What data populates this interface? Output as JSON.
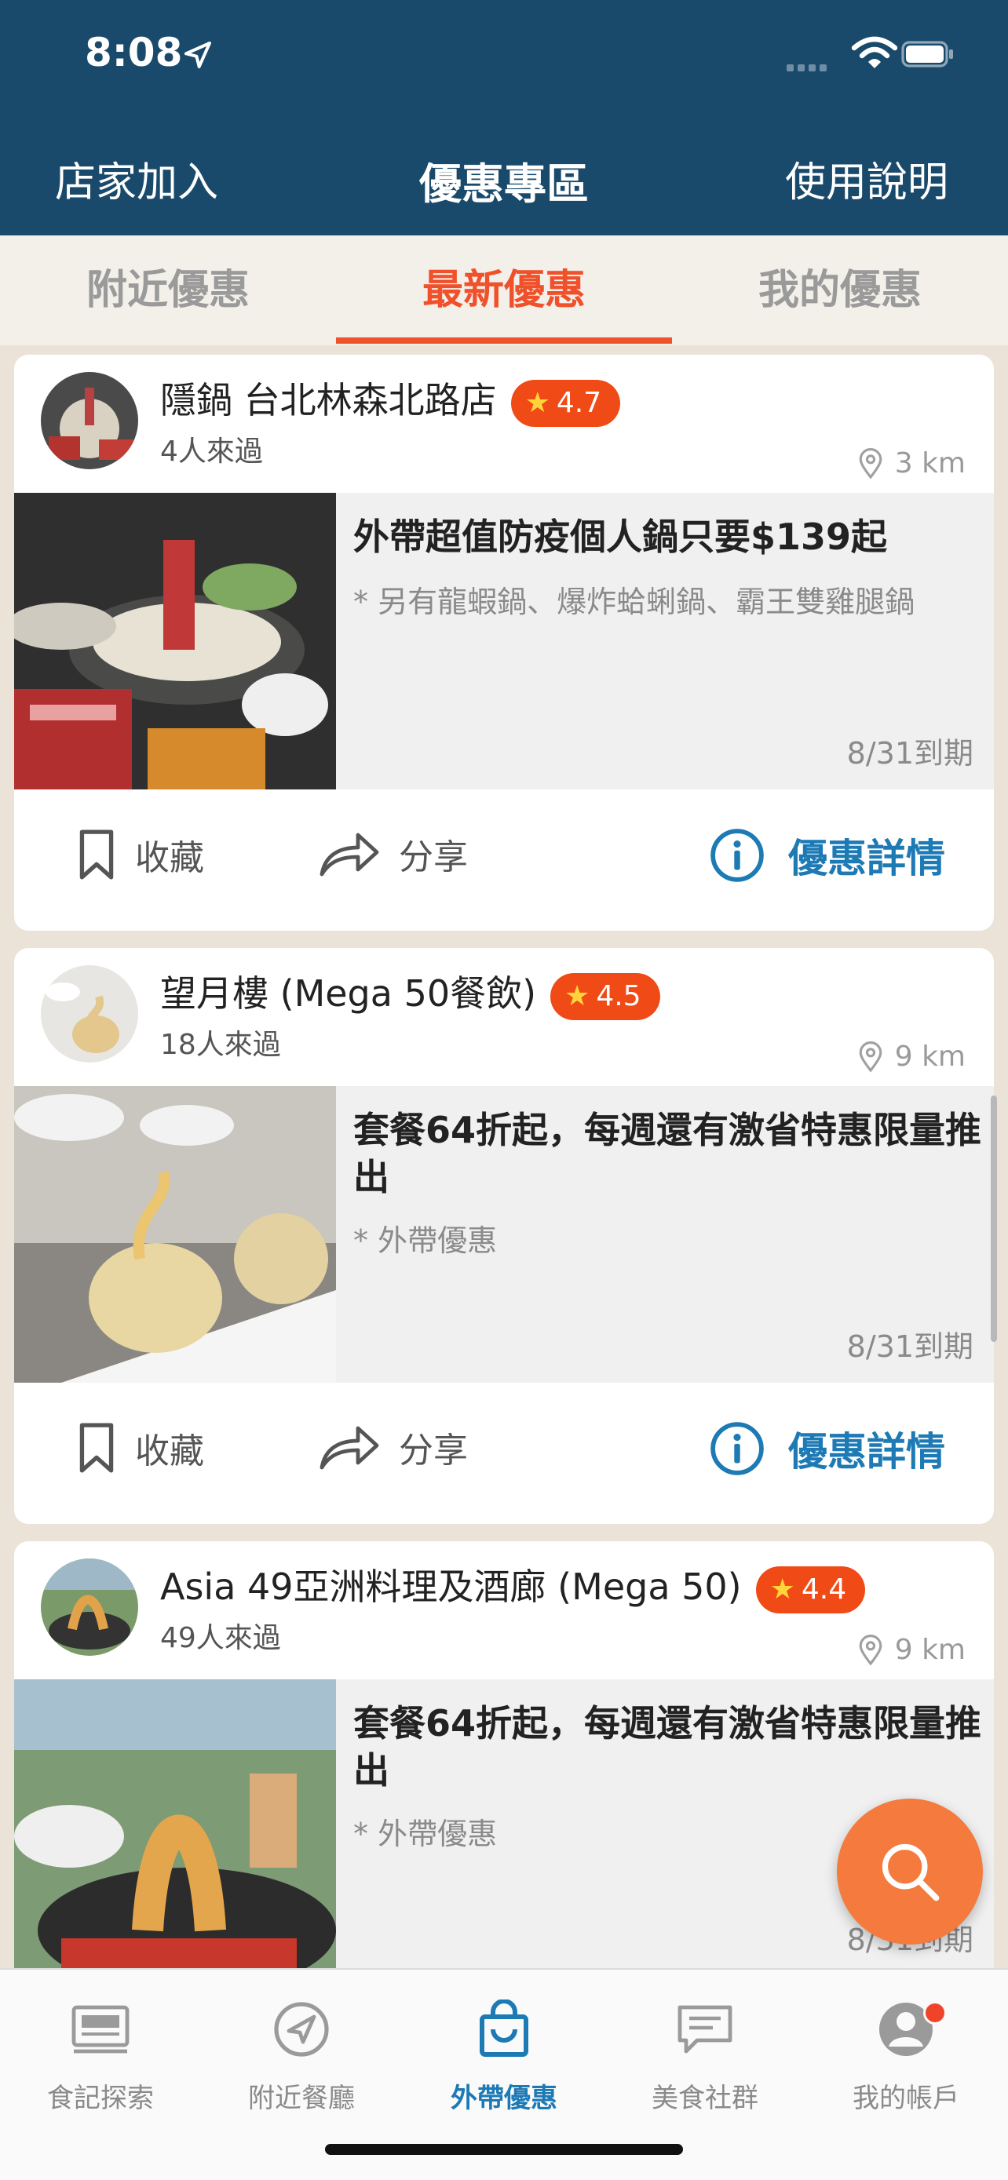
{
  "status_bar": {
    "time": "8:08"
  },
  "header": {
    "left": "店家加入",
    "title": "優惠專區",
    "right": "使用說明"
  },
  "tabs": [
    {
      "label": "附近優惠",
      "active": false
    },
    {
      "label": "最新優惠",
      "active": true
    },
    {
      "label": "我的優惠",
      "active": false
    }
  ],
  "cards": [
    {
      "store": "隱鍋 台北林森北路店",
      "rating": "4.7",
      "visits": "4人來過",
      "distance": "3 km",
      "deal_title": "外帶超值防疫個人鍋只要$139起",
      "deal_sub": "* 另有龍蝦鍋、爆炸蛤蜊鍋、霸王雙雞腿鍋",
      "expiry": "8/31到期",
      "save": "收藏",
      "share": "分享",
      "detail": "優惠詳情"
    },
    {
      "store": "望月樓 (Mega 50餐飲)",
      "rating": "4.5",
      "visits": "18人來過",
      "distance": "9 km",
      "deal_title": "套餐64折起，每週還有激省特惠限量推出",
      "deal_sub": "* 外帶優惠",
      "expiry": "8/31到期",
      "save": "收藏",
      "share": "分享",
      "detail": "優惠詳情"
    },
    {
      "store": "Asia 49亞洲料理及酒廊 (Mega 50)",
      "rating": "4.4",
      "visits": "49人來過",
      "distance": "9 km",
      "deal_title": "套餐64折起，每週還有激省特惠限量推出",
      "deal_sub": "* 外帶優惠",
      "expiry": "8/31到期"
    }
  ],
  "bottom_tabs": [
    {
      "label": "食記探索",
      "icon": "newspaper-icon"
    },
    {
      "label": "附近餐廳",
      "icon": "compass-icon"
    },
    {
      "label": "外帶優惠",
      "icon": "shopping-bag-icon",
      "active": true
    },
    {
      "label": "美食社群",
      "icon": "chat-icon"
    },
    {
      "label": "我的帳戶",
      "icon": "account-icon",
      "has_badge": true
    }
  ],
  "colors": {
    "header": "#1a4a6b",
    "accent": "#f0502a",
    "link": "#1d7ab5",
    "fab": "#f47a3e"
  }
}
